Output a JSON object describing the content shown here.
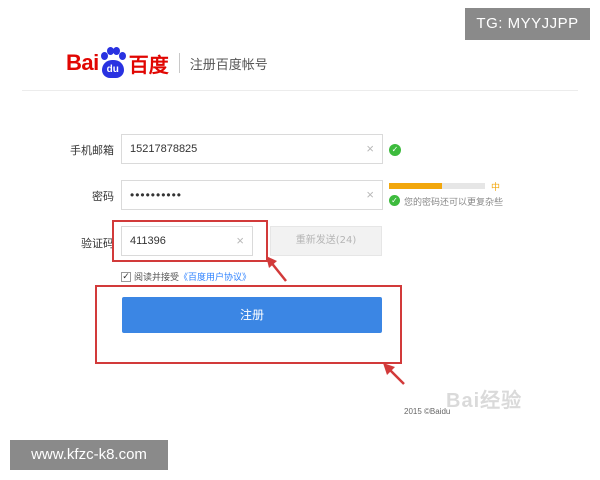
{
  "overlay": {
    "tg_text": "TG: MYYJJPP",
    "site_text": "www.kfzc-k8.com"
  },
  "header": {
    "logo_bai": "Bai",
    "logo_du": "du",
    "logo_cn": "百度",
    "subtitle": "注册百度帐号"
  },
  "form": {
    "phone": {
      "label": "手机邮箱",
      "value": "15217878825",
      "clear_glyph": "×",
      "status": "valid"
    },
    "password": {
      "label": "密码",
      "value": "••••••••••",
      "clear_glyph": "×",
      "strength_label": "中",
      "strength_level": 0.55,
      "tip": "您的密码还可以更复杂些"
    },
    "code": {
      "label": "验证码",
      "value": "411396",
      "clear_glyph": "×"
    },
    "resend_label": "重新发送(24)",
    "agree_text": "阅读并接受",
    "agree_link": "《百度用户协议》",
    "agree_checked": true,
    "register_label": "注册"
  },
  "footer": {
    "copyright": "2015 ©Baidu",
    "watermark": "Bai经验"
  },
  "colors": {
    "brand_red": "#e10602",
    "brand_blue": "#2932e1",
    "button_blue": "#3b86e4",
    "annotation_red": "#d23a3a",
    "ok_green": "#3dbb3d",
    "strength_orange": "#f2a70d"
  }
}
